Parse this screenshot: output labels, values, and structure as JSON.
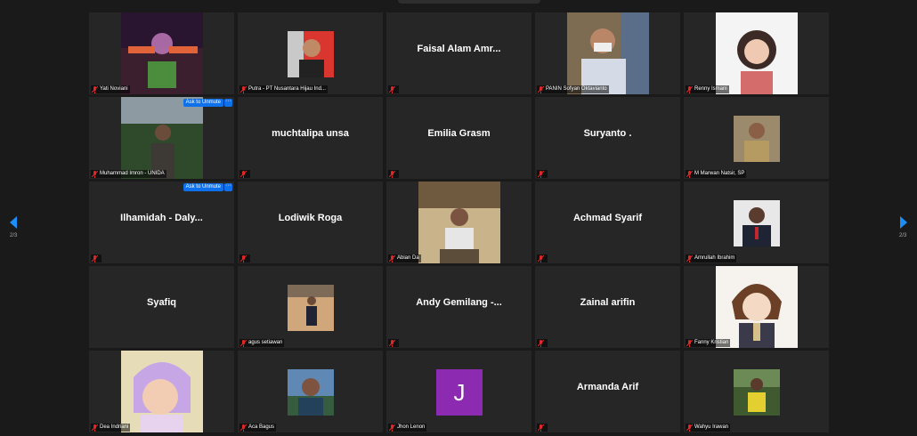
{
  "colors": {
    "background": "#1a1a1a",
    "tile": "#262626",
    "accent": "#0e71eb",
    "muted_mic": "#e02828",
    "nav_arrow": "#1c8ef9"
  },
  "pager": {
    "left": "2/3",
    "right": "2/3"
  },
  "unmute_label": "Ask to Unmute",
  "more_label": "···",
  "avatar_j": "J",
  "participants": [
    {
      "name": "Yati Noviani"
    },
    {
      "name": "Putra - PT Nusantara Hijau Ind..."
    },
    {
      "name": "Faisal Alam Amr..."
    },
    {
      "name": "PANIN Sofyan Oktavianto"
    },
    {
      "name": "Renny Ismani"
    },
    {
      "name": "Muhammad Imron - UNIDA"
    },
    {
      "name": "muchtalipa unsa"
    },
    {
      "name": "Emilia Grasm"
    },
    {
      "name": "Suryanto ."
    },
    {
      "name": "M Marwan Natsir, SP"
    },
    {
      "name": "Ilhamidah - Daly..."
    },
    {
      "name": "Lodiwik Roga"
    },
    {
      "name": "Abian Da"
    },
    {
      "name": "Achmad Syarif"
    },
    {
      "name": "Amrullah Ibrahim"
    },
    {
      "name": "Syafiq"
    },
    {
      "name": "agus setiawan"
    },
    {
      "name": "Andy Gemilang -..."
    },
    {
      "name": "Zainal arifin"
    },
    {
      "name": "Fanny Kristian"
    },
    {
      "name": "Dea Indriani"
    },
    {
      "name": "Aca Bagus"
    },
    {
      "name": "Jhon Lenon"
    },
    {
      "name": "Armanda Arif"
    },
    {
      "name": "Wahyu Irawan"
    }
  ]
}
